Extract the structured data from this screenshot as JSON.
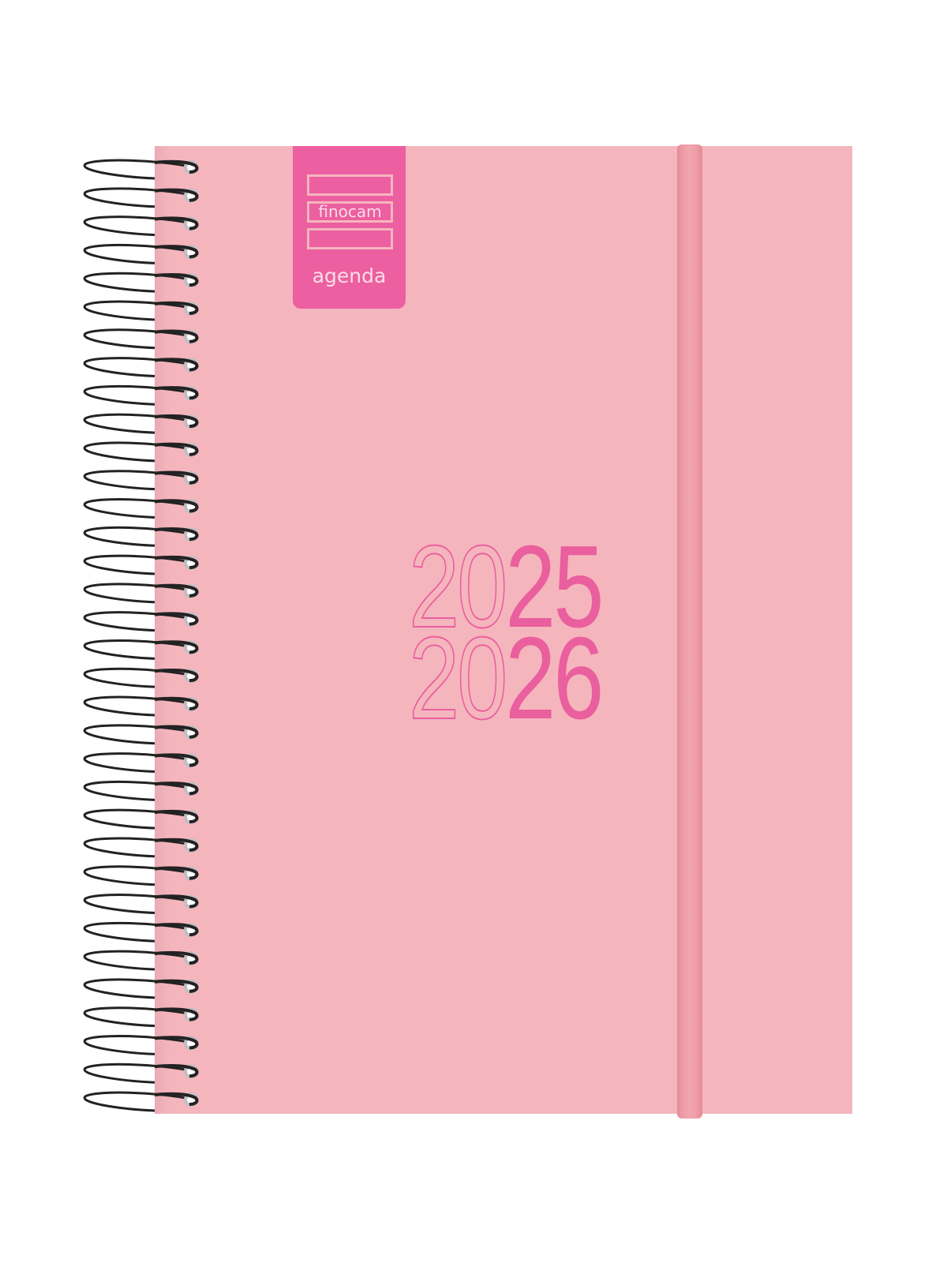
{
  "product": {
    "brand": "finocam",
    "product_word": "agenda",
    "years": [
      {
        "outline": "20",
        "solid": "25"
      },
      {
        "outline": "20",
        "solid": "26"
      }
    ]
  },
  "colors": {
    "cover": "#f5b5bd",
    "accent": "#ea5f9e",
    "elastic": "#ee9ea8",
    "wire": "#222222"
  },
  "spiral": {
    "ring_count": 34
  }
}
